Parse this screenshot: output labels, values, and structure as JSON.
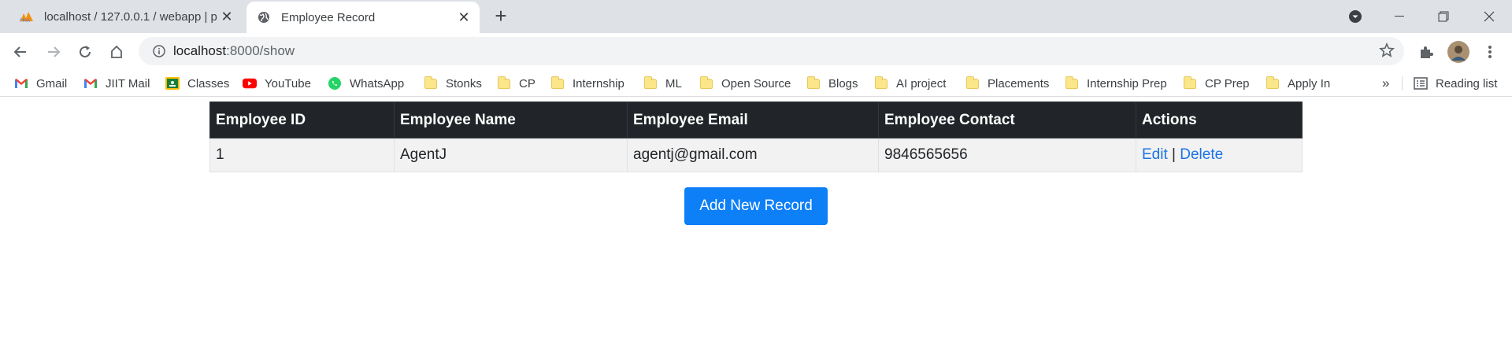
{
  "tabs": [
    {
      "title": "localhost / 127.0.0.1 / webapp | p",
      "favicon": "phpmyadmin-icon"
    },
    {
      "title": "Employee Record",
      "favicon": "globe-icon"
    }
  ],
  "address": {
    "host": "localhost",
    "path": ":8000/show"
  },
  "bookmarks": [
    {
      "label": "Gmail",
      "icon": "gmail-icon"
    },
    {
      "label": "JIIT Mail",
      "icon": "gmail-icon"
    },
    {
      "label": "Classes",
      "icon": "classroom-icon"
    },
    {
      "label": "YouTube",
      "icon": "youtube-icon"
    },
    {
      "label": "WhatsApp",
      "icon": "whatsapp-icon"
    },
    {
      "label": "Stonks",
      "icon": "folder-icon"
    },
    {
      "label": "CP",
      "icon": "folder-icon"
    },
    {
      "label": "Internship",
      "icon": "folder-icon"
    },
    {
      "label": "ML",
      "icon": "folder-icon"
    },
    {
      "label": "Open Source",
      "icon": "folder-icon"
    },
    {
      "label": "Blogs",
      "icon": "folder-icon"
    },
    {
      "label": "AI project",
      "icon": "folder-icon"
    },
    {
      "label": "Placements",
      "icon": "folder-icon"
    },
    {
      "label": "Internship Prep",
      "icon": "folder-icon"
    },
    {
      "label": "CP Prep",
      "icon": "folder-icon"
    },
    {
      "label": "Apply In",
      "icon": "folder-icon"
    }
  ],
  "overflow": "»",
  "reading_list": "Reading list",
  "table": {
    "headers": [
      "Employee ID",
      "Employee Name",
      "Employee Email",
      "Employee Contact",
      "Actions"
    ],
    "rows": [
      {
        "id": "1",
        "name": "AgentJ",
        "email": "agentj@gmail.com",
        "contact": "9846565656",
        "edit": "Edit",
        "sep": "|",
        "delete": "Delete"
      }
    ]
  },
  "add_button": "Add New Record",
  "colors": {
    "header_bg": "#212529",
    "link": "#1a73e8",
    "button": "#0d7ff7"
  }
}
